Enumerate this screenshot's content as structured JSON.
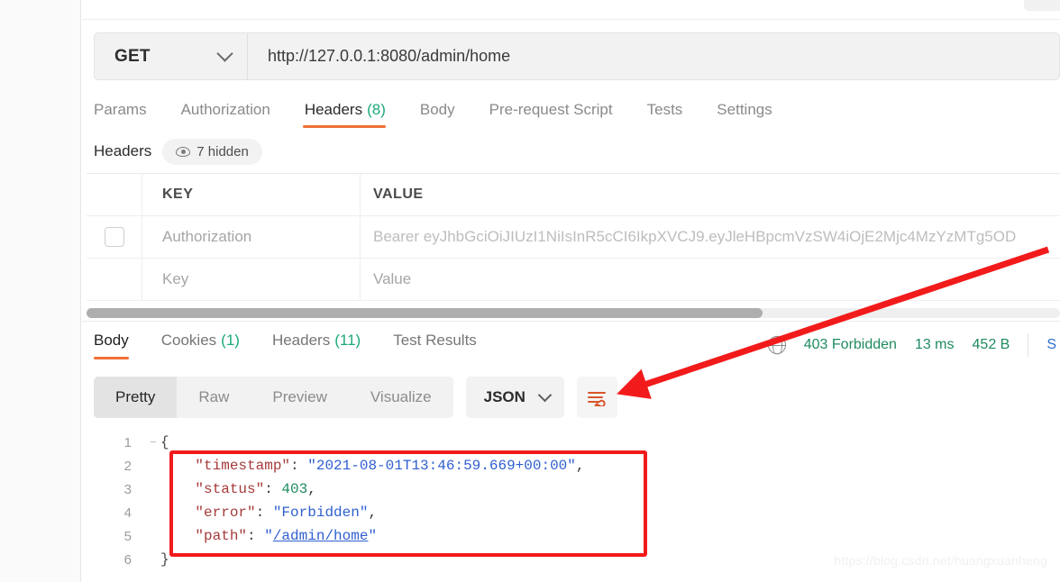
{
  "request": {
    "method": "GET",
    "url": "http://127.0.0.1:8080/admin/home",
    "tabs": [
      {
        "label": "Params",
        "count": "",
        "active": false
      },
      {
        "label": "Authorization",
        "count": "",
        "active": false
      },
      {
        "label": "Headers",
        "count": "(8)",
        "active": true
      },
      {
        "label": "Body",
        "count": "",
        "active": false
      },
      {
        "label": "Pre-request Script",
        "count": "",
        "active": false
      },
      {
        "label": "Tests",
        "count": "",
        "active": false
      },
      {
        "label": "Settings",
        "count": "",
        "active": false
      }
    ],
    "headers_subtitle": "Headers",
    "hidden_pill": "7 hidden",
    "table": {
      "columns": [
        "KEY",
        "VALUE"
      ],
      "rows": [
        {
          "checked": false,
          "key": "Authorization",
          "value": "Bearer eyJhbGciOiJIUzI1NiIsInR5cCI6IkpXVCJ9.eyJleHBpcmVzSW4iOjE2Mjc4MzYzMTg5OD"
        },
        {
          "checked": false,
          "key": "Key",
          "value": "Value"
        }
      ]
    }
  },
  "response": {
    "tabs": [
      {
        "label": "Body",
        "count": "",
        "active": true
      },
      {
        "label": "Cookies",
        "count": "(1)",
        "active": false
      },
      {
        "label": "Headers",
        "count": "(11)",
        "active": false
      },
      {
        "label": "Test Results",
        "count": "",
        "active": false
      }
    ],
    "status": "403 Forbidden",
    "time": "13 ms",
    "size": "452 B",
    "save_label": "S",
    "globe_icon": "globe-icon",
    "view_modes": [
      {
        "label": "Pretty",
        "active": true
      },
      {
        "label": "Raw",
        "active": false
      },
      {
        "label": "Preview",
        "active": false
      },
      {
        "label": "Visualize",
        "active": false
      }
    ],
    "format": "JSON",
    "wrap_icon": "word-wrap-icon",
    "body_lines": [
      {
        "num": "1",
        "fold": "−",
        "tokens": [
          {
            "t": "{",
            "c": "j-brace"
          }
        ]
      },
      {
        "num": "2",
        "fold": "",
        "tokens": [
          {
            "t": "    ",
            "c": "j-punct"
          },
          {
            "t": "\"timestamp\"",
            "c": "j-key"
          },
          {
            "t": ": ",
            "c": "j-punct"
          },
          {
            "t": "\"2021-08-01T13:46:59.669+00:00\"",
            "c": "j-str"
          },
          {
            "t": ",",
            "c": "j-punct"
          }
        ]
      },
      {
        "num": "3",
        "fold": "",
        "tokens": [
          {
            "t": "    ",
            "c": "j-punct"
          },
          {
            "t": "\"status\"",
            "c": "j-key"
          },
          {
            "t": ": ",
            "c": "j-punct"
          },
          {
            "t": "403",
            "c": "j-num"
          },
          {
            "t": ",",
            "c": "j-punct"
          }
        ]
      },
      {
        "num": "4",
        "fold": "",
        "tokens": [
          {
            "t": "    ",
            "c": "j-punct"
          },
          {
            "t": "\"error\"",
            "c": "j-key"
          },
          {
            "t": ": ",
            "c": "j-punct"
          },
          {
            "t": "\"Forbidden\"",
            "c": "j-str"
          },
          {
            "t": ",",
            "c": "j-punct"
          }
        ]
      },
      {
        "num": "5",
        "fold": "",
        "tokens": [
          {
            "t": "    ",
            "c": "j-punct"
          },
          {
            "t": "\"path\"",
            "c": "j-key"
          },
          {
            "t": ": ",
            "c": "j-punct"
          },
          {
            "t": "\"",
            "c": "j-str"
          },
          {
            "t": "/admin/home",
            "c": "j-link"
          },
          {
            "t": "\"",
            "c": "j-str"
          }
        ]
      },
      {
        "num": "6",
        "fold": "",
        "tokens": [
          {
            "t": "}",
            "c": "j-brace"
          }
        ]
      }
    ]
  },
  "annotation": {
    "highlight_color": "#f21b1b",
    "arrow_color": "#f21b1b"
  },
  "watermark": "https://blog.csdn.net/huangxuanheng"
}
